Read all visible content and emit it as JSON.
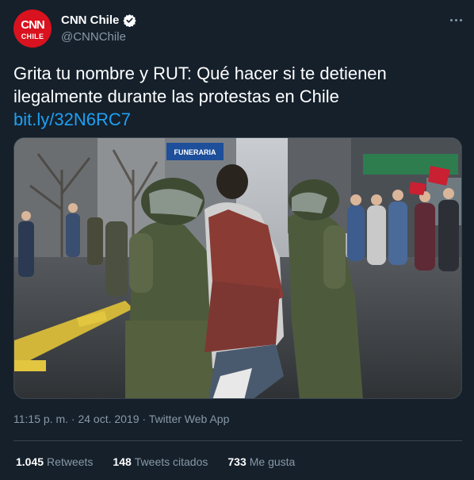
{
  "account": {
    "display_name": "CNN Chile",
    "handle": "@CNNChile",
    "avatar_logo_top": "CNN",
    "avatar_logo_bottom": "CHILE",
    "verified": true
  },
  "tweet": {
    "text": "Grita tu nombre y RUT: Qué hacer si te detienen ilegalmente durante las protestas en Chile",
    "link": "bit.ly/32N6RC7",
    "media_sign_text": "FUNERARIA",
    "timestamp": "11:15 p. m. · 24 oct. 2019 · Twitter Web App"
  },
  "stats": {
    "retweets_count": "1.045",
    "retweets_label": "Retweets",
    "quotes_count": "148",
    "quotes_label": "Tweets citados",
    "likes_count": "733",
    "likes_label": "Me gusta"
  },
  "colors": {
    "background": "#15202b",
    "link": "#1da1f2",
    "muted": "#8899a6",
    "brand_red": "#d8121e"
  }
}
